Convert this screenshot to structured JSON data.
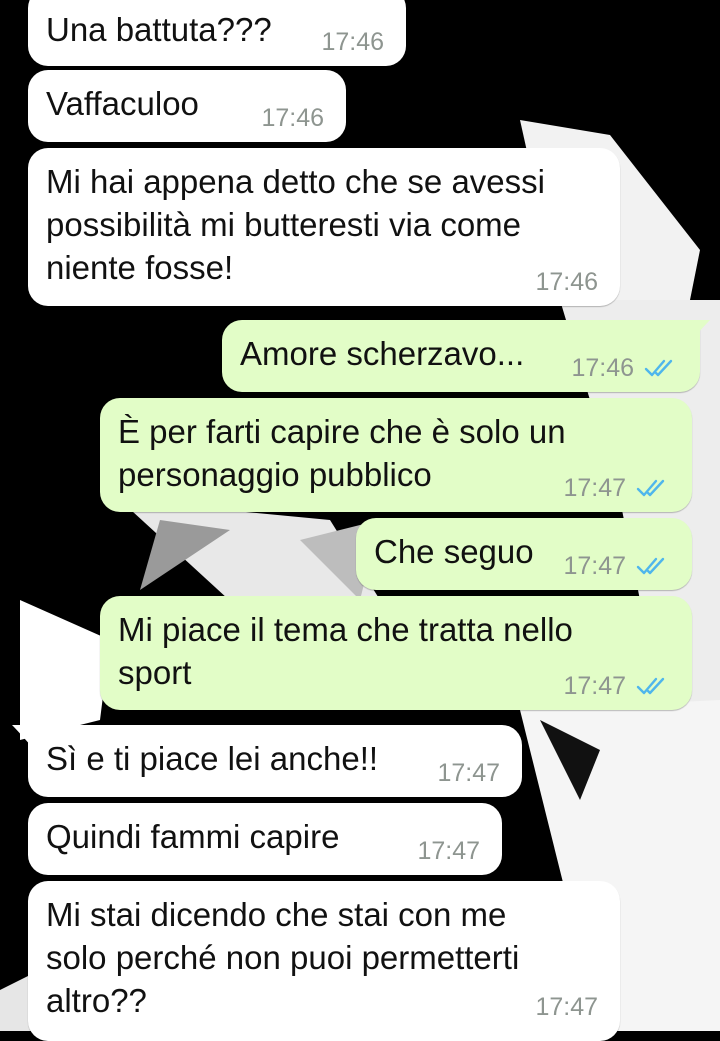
{
  "colors": {
    "incoming_bubble": "#ffffff",
    "outgoing_bubble": "#e2fdc7",
    "timestamp": "#8e9590",
    "read_ticks": "#4fb6ec",
    "text": "#111111"
  },
  "messages": [
    {
      "direction": "incoming",
      "text": "Una battuta???",
      "time": "17:46"
    },
    {
      "direction": "incoming",
      "text": "Vaffaculoo",
      "time": "17:46"
    },
    {
      "direction": "incoming",
      "text": "Mi hai appena detto che se avessi\npossibilità mi butteresti via come\nniente fosse!",
      "time": "17:46"
    },
    {
      "direction": "outgoing",
      "text": "Amore scherzavo...",
      "time": "17:46",
      "status_icon": "double-check-read-icon"
    },
    {
      "direction": "outgoing",
      "text": "È per farti capire che è solo un\npersonaggio pubblico",
      "time": "17:47",
      "status_icon": "double-check-read-icon"
    },
    {
      "direction": "outgoing",
      "text": "Che seguo",
      "time": "17:47",
      "status_icon": "double-check-read-icon"
    },
    {
      "direction": "outgoing",
      "text": "Mi piace il tema che tratta nello\nsport",
      "time": "17:47",
      "status_icon": "double-check-read-icon"
    },
    {
      "direction": "incoming",
      "text": "Sì e ti piace lei anche!!",
      "time": "17:47"
    },
    {
      "direction": "incoming",
      "text": "Quindi fammi capire",
      "time": "17:47"
    },
    {
      "direction": "incoming",
      "text": "Mi stai dicendo che stai con me\nsolo perché non puoi permetterti\naltro??",
      "time": "17:47"
    }
  ]
}
